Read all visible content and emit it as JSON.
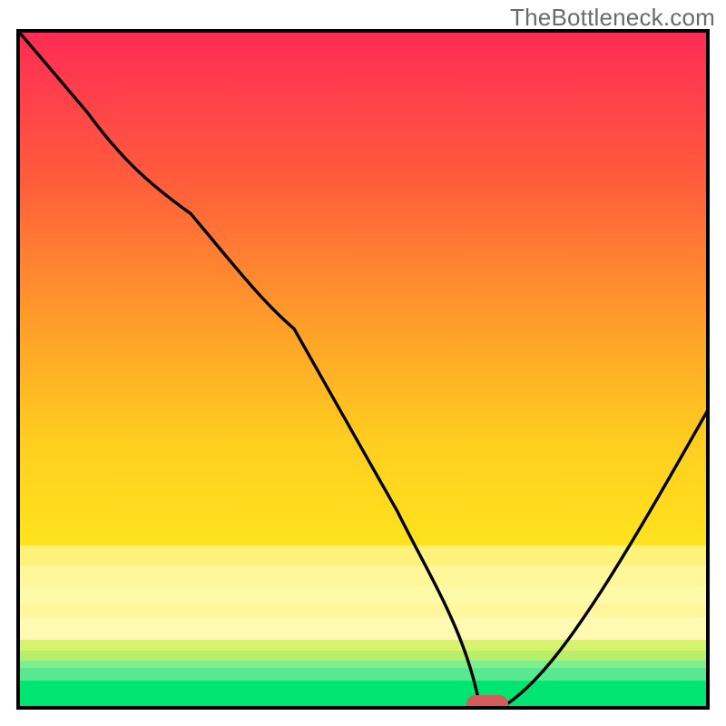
{
  "watermark": "TheBottleneck.com",
  "chart_data": {
    "type": "line",
    "title": "",
    "xlabel": "",
    "ylabel": "",
    "xlim": [
      0,
      100
    ],
    "ylim": [
      0,
      100
    ],
    "grid": false,
    "legend": false,
    "x": [
      0,
      5,
      10,
      15,
      20,
      25,
      30,
      35,
      40,
      45,
      50,
      55,
      60,
      65,
      67,
      70,
      75,
      80,
      85,
      90,
      95,
      100
    ],
    "values": [
      100,
      94,
      88,
      82,
      78,
      73,
      65,
      56,
      47,
      38,
      29,
      20,
      11,
      3,
      0,
      0,
      3,
      10,
      18,
      26,
      35,
      44
    ],
    "optimal_x": 68,
    "optimal_width": 6,
    "bands": [
      {
        "name": "red-to-yellow-gradient",
        "from_y": 24,
        "to_y": 100
      },
      {
        "name": "pale-yellow",
        "from_y": 10,
        "to_y": 24
      },
      {
        "name": "yellow-green",
        "from_y": 7,
        "to_y": 10
      },
      {
        "name": "light-green",
        "from_y": 4,
        "to_y": 7
      },
      {
        "name": "green",
        "from_y": 0,
        "to_y": 4
      }
    ],
    "colors": {
      "top_red": "#ff2b56",
      "mid_orange": "#ff8a2a",
      "yellow": "#ffde1e",
      "pale_yellow": "#fff79a",
      "yellow_green": "#d7f26d",
      "light_green": "#59e890",
      "green": "#00e472",
      "curve": "#000000",
      "marker": "#d35c5c",
      "border": "#000000"
    }
  }
}
